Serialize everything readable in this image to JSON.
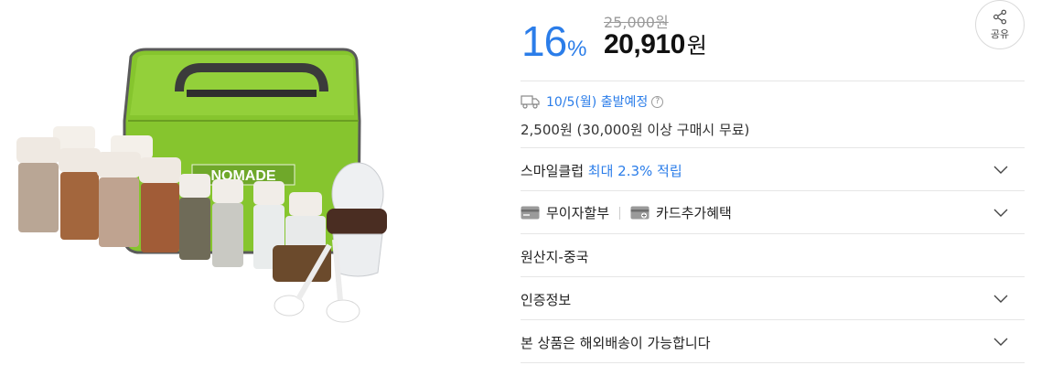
{
  "product": {
    "image_alt": "NOMADE spice container set",
    "brand_on_bag": "NOMADE"
  },
  "price": {
    "discount_value": "16",
    "discount_unit": "%",
    "original_price": "25,000원",
    "sale_amount": "20,910",
    "currency": "원"
  },
  "share": {
    "label": "공유",
    "icon": "share-icon"
  },
  "shipping": {
    "icon": "truck-icon",
    "date_text": "10/5(월) 출발예정",
    "help_icon_glyph": "?",
    "fee_text": "2,500원 (30,000원 이상 구매시 무료)"
  },
  "smile_club": {
    "label": "스마일클럽",
    "accent": "최대 2.3% 적립"
  },
  "payment": {
    "installment_label": "무이자할부",
    "card_benefit_label": "카드추가혜택"
  },
  "origin": {
    "label": "원산지-중국"
  },
  "certification": {
    "label": "인증정보"
  },
  "overseas": {
    "label": "본 상품은 해외배송이 가능합니다"
  },
  "colors": {
    "accent_blue": "#2b7de9",
    "bag_green": "#86c52e",
    "divider": "#e6e6e6"
  }
}
